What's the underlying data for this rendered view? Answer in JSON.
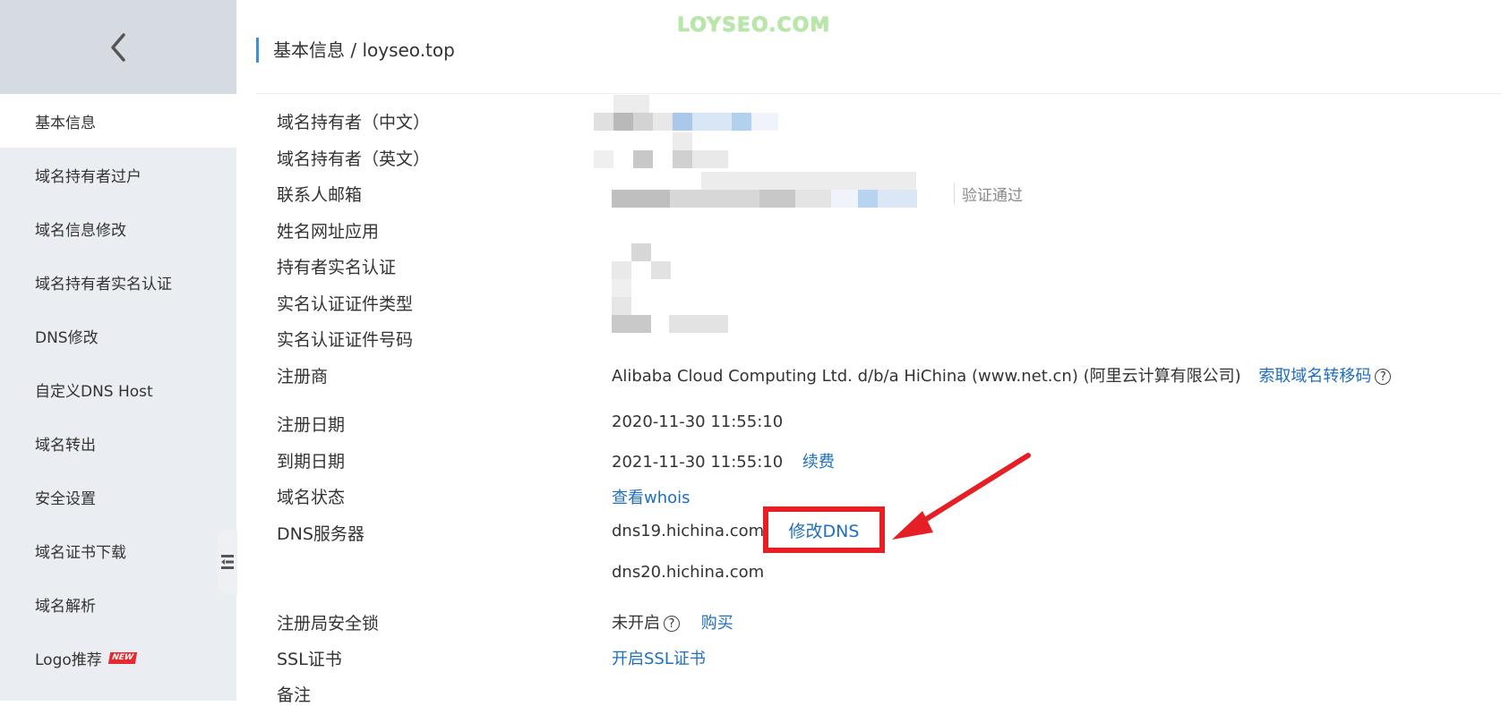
{
  "watermark": "LOYSEO.COM",
  "breadcrumb": "基本信息 / loyseo.top",
  "sidebar": {
    "items": [
      {
        "label": "基本信息",
        "active": true
      },
      {
        "label": "域名持有者过户"
      },
      {
        "label": "域名信息修改"
      },
      {
        "label": "域名持有者实名认证"
      },
      {
        "label": "DNS修改"
      },
      {
        "label": "自定义DNS Host"
      },
      {
        "label": "域名转出"
      },
      {
        "label": "安全设置"
      },
      {
        "label": "域名证书下载"
      },
      {
        "label": "域名解析"
      },
      {
        "label": "Logo推荐",
        "badge": "NEW"
      }
    ]
  },
  "info": {
    "owner_cn_label": "域名持有者（中文）",
    "owner_en_label": "域名持有者（英文）",
    "email_label": "联系人邮箱",
    "email_status": "验证通过",
    "name_url_label": "姓名网址应用",
    "realname_label": "持有者实名认证",
    "cert_type_label": "实名认证证件类型",
    "cert_no_label": "实名认证证件号码",
    "registrar_label": "注册商",
    "registrar_value": "Alibaba Cloud Computing Ltd. d/b/a HiChina (www.net.cn) (阿里云计算有限公司)",
    "registrar_link": "索取域名转移码",
    "reg_date_label": "注册日期",
    "reg_date_value": "2020-11-30 11:55:10",
    "exp_date_label": "到期日期",
    "exp_date_value": "2021-11-30 11:55:10",
    "renew_link": "续费",
    "status_label": "域名状态",
    "whois_link": "查看whois",
    "dns_label": "DNS服务器",
    "dns1": "dns19.hichina.com",
    "dns_modify_link": "修改DNS",
    "dns2": "dns20.hichina.com",
    "lock_label": "注册局安全锁",
    "lock_value": "未开启",
    "buy_link": "购买",
    "ssl_label": "SSL证书",
    "ssl_link": "开启SSL证书",
    "remark_label": "备注"
  },
  "colors": {
    "sidebar_bg": "#eaedf1",
    "link": "#1e6fbf",
    "highlight": "#e61f26"
  }
}
